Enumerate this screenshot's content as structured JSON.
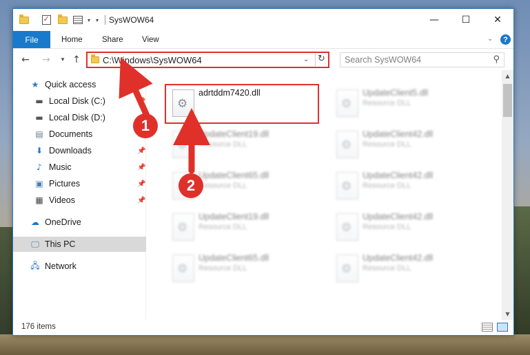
{
  "window": {
    "title": "SysWOW64",
    "controls": {
      "minimize": "—",
      "maximize": "☐",
      "close": "✕"
    }
  },
  "ribbon": {
    "tabs": [
      "File",
      "Home",
      "Share",
      "View"
    ]
  },
  "address_bar": {
    "path": "C:\\Windows\\SysWOW64"
  },
  "search": {
    "placeholder": "Search SysWOW64"
  },
  "nav_pane": {
    "items": [
      {
        "label": "Quick access",
        "icon": "star-icon",
        "pinned": false
      },
      {
        "label": "Local Disk (C:)",
        "icon": "drive-icon",
        "pinned": true
      },
      {
        "label": "Local Disk (D:)",
        "icon": "drive-icon",
        "pinned": true
      },
      {
        "label": "Documents",
        "icon": "documents-icon",
        "pinned": true
      },
      {
        "label": "Downloads",
        "icon": "downloads-icon",
        "pinned": true
      },
      {
        "label": "Music",
        "icon": "music-icon",
        "pinned": true
      },
      {
        "label": "Pictures",
        "icon": "pictures-icon",
        "pinned": true
      },
      {
        "label": "Videos",
        "icon": "videos-icon",
        "pinned": true
      },
      {
        "label": "OneDrive",
        "icon": "onedrive-icon",
        "pinned": false
      },
      {
        "label": "This PC",
        "icon": "computer-icon",
        "pinned": false,
        "selected": true
      },
      {
        "label": "Network",
        "icon": "network-icon",
        "pinned": false
      }
    ]
  },
  "files": [
    {
      "name": "adrtddm7420.dll",
      "type": "",
      "highlighted": true
    },
    {
      "name": "UpdateClient5.dll",
      "type": "Resource DLL",
      "blurred": true
    },
    {
      "name": "UpdateClient19.dll",
      "type": "Resource DLL",
      "blurred": true
    },
    {
      "name": "UpdateClient42.dll",
      "type": "Resource DLL",
      "blurred": true
    },
    {
      "name": "UpdateClient65.dll",
      "type": "Resource DLL",
      "blurred": true
    },
    {
      "name": "UpdateClient42.dll",
      "type": "Resource DLL",
      "blurred": true
    },
    {
      "name": "UpdateClient19.dll",
      "type": "Resource DLL",
      "blurred": true
    },
    {
      "name": "UpdateClient42.dll",
      "type": "Resource DLL",
      "blurred": true
    },
    {
      "name": "UpdateClient65.dll",
      "type": "Resource DLL",
      "blurred": true
    },
    {
      "name": "UpdateClient42.dll",
      "type": "Resource DLL",
      "blurred": true
    }
  ],
  "status": {
    "item_count": "176 items"
  },
  "annotations": {
    "step1": "1",
    "step2": "2",
    "color": "#e0302a"
  }
}
